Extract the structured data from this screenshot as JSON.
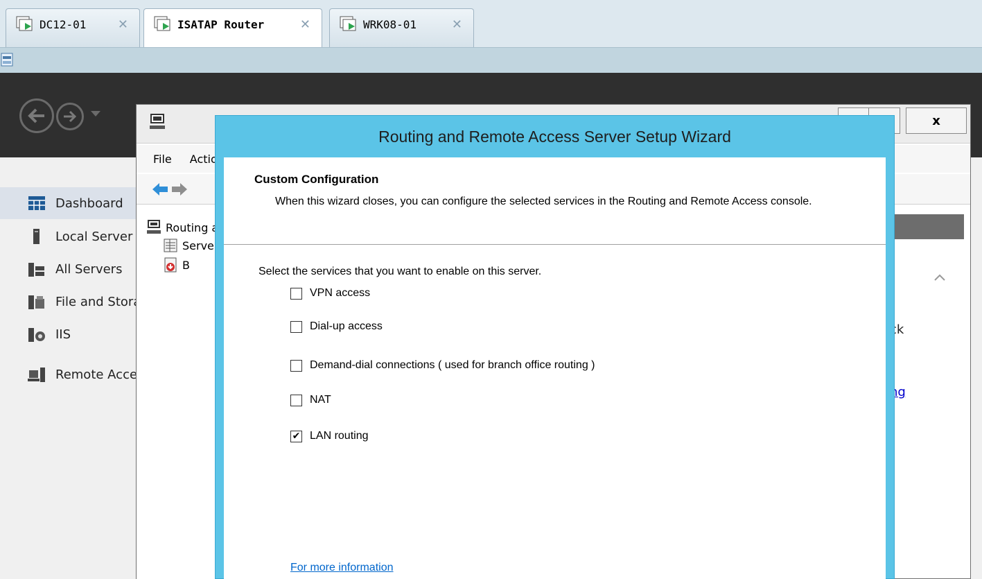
{
  "vm_tabs": [
    {
      "label": "DC12-01",
      "close": "✕",
      "icon": "vm-console-icon"
    },
    {
      "label": "ISATAP Router",
      "close": "✕",
      "icon": "vm-console-icon",
      "active": true
    },
    {
      "label": "WRK08-01",
      "close": "✕",
      "icon": "vm-console-icon"
    }
  ],
  "server_manager": {
    "sidebar": [
      {
        "label": "Dashboard",
        "icon": "dashboard-icon",
        "active": true
      },
      {
        "label": "Local Server",
        "icon": "local-server-icon"
      },
      {
        "label": "All Servers",
        "icon": "all-servers-icon"
      },
      {
        "label": "File and Storage Services",
        "icon": "file-storage-icon"
      },
      {
        "label": "IIS",
        "icon": "iis-icon"
      },
      {
        "label": "Remote Access",
        "icon": "remote-access-icon"
      }
    ]
  },
  "mmc": {
    "menu": [
      "File",
      "Action"
    ],
    "tree": [
      {
        "label": "Routing and Remote Access",
        "icon": "rras-icon"
      },
      {
        "label": "Server Status",
        "icon": "server-status-icon"
      },
      {
        "label": "B",
        "icon": "server-down-icon"
      }
    ],
    "close_label": "x",
    "right_text": "ick",
    "right_link": "ing"
  },
  "wizard": {
    "title": "Routing and Remote Access Server Setup Wizard",
    "heading": "Custom Configuration",
    "description": "When this wizard closes, you can configure the selected services in the Routing and Remote Access console.",
    "prompt": "Select the services that you want to enable on this server.",
    "options": [
      {
        "label": "VPN access",
        "checked": false
      },
      {
        "label": "Dial-up access",
        "checked": false
      },
      {
        "label": "Demand-dial connections ( used for branch office routing )",
        "checked": false
      },
      {
        "label": "NAT",
        "checked": false
      },
      {
        "label": "LAN routing",
        "checked": true
      }
    ],
    "more_info_link": "For more information"
  },
  "colors": {
    "wizard_border": "#5bc4e7",
    "sm_header": "#2f2f2f",
    "link": "#0066cc"
  }
}
